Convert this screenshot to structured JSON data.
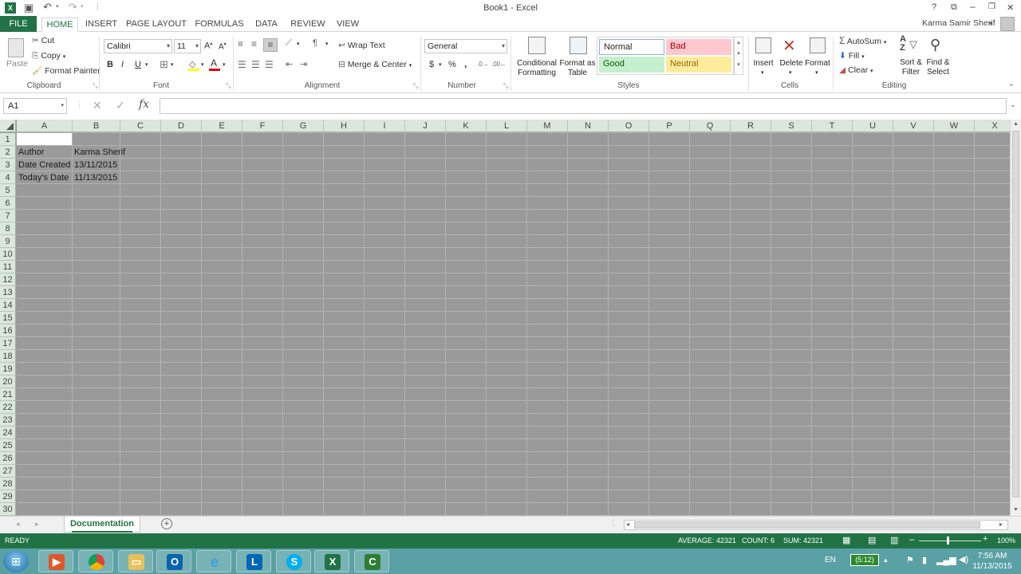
{
  "window": {
    "title": "Book1 - Excel",
    "user": "Karma Samir Sherif",
    "help_glyph": "?",
    "min_glyph": "–",
    "restore_glyph": "❐",
    "close_glyph": "✕"
  },
  "tabs": [
    "FILE",
    "HOME",
    "INSERT",
    "PAGE LAYOUT",
    "FORMULAS",
    "DATA",
    "REVIEW",
    "VIEW"
  ],
  "active_tab": "HOME",
  "clipboard": {
    "paste": "Paste",
    "cut": "Cut",
    "copy": "Copy",
    "format_painter": "Format Painter",
    "label": "Clipboard"
  },
  "font": {
    "name": "Calibri",
    "size": "11",
    "bold": "B",
    "italic": "I",
    "underline": "U",
    "label": "Font"
  },
  "alignment": {
    "wrap_text": "Wrap Text",
    "merge_center": "Merge & Center",
    "label": "Alignment"
  },
  "number": {
    "format": "General",
    "currency": "$",
    "percent": "%",
    "comma": ",",
    "label": "Number"
  },
  "styles": {
    "conditional_formatting": "Conditional Formatting",
    "format_as_table": "Format as Table",
    "normal": "Normal",
    "bad": "Bad",
    "good": "Good",
    "neutral": "Neutral",
    "label": "Styles"
  },
  "cells": {
    "insert": "Insert",
    "delete": "Delete",
    "format": "Format",
    "label": "Cells"
  },
  "editing": {
    "autosum": "AutoSum",
    "fill": "Fill",
    "clear": "Clear",
    "sort_filter": "Sort & Filter",
    "find_select": "Find & Select",
    "label": "Editing"
  },
  "formula_bar": {
    "name_box": "A1",
    "cancel": "✕",
    "enter": "✓",
    "fx": "fx",
    "value": ""
  },
  "columns": [
    "A",
    "B",
    "C",
    "D",
    "E",
    "F",
    "G",
    "H",
    "I",
    "J",
    "K",
    "L",
    "M",
    "N",
    "O",
    "P",
    "Q",
    "R",
    "S",
    "T",
    "U",
    "V",
    "W",
    "X"
  ],
  "rows": [
    "1",
    "2",
    "3",
    "4",
    "5",
    "6",
    "7",
    "8",
    "9",
    "10",
    "11",
    "12",
    "13",
    "14",
    "15",
    "16",
    "17",
    "18",
    "19",
    "20",
    "21",
    "22",
    "23",
    "24",
    "25",
    "26",
    "27",
    "28",
    "29",
    "30"
  ],
  "cells_data": [
    {
      "ref": "A2",
      "value": "Author"
    },
    {
      "ref": "B2",
      "value": "Karma Sherif"
    },
    {
      "ref": "A3",
      "value": "Date Created"
    },
    {
      "ref": "B3",
      "value": "13/11/2015"
    },
    {
      "ref": "A4",
      "value": "Today's Date"
    },
    {
      "ref": "B4",
      "value": "11/13/2015"
    }
  ],
  "sheets": [
    "Documentation"
  ],
  "status": {
    "mode": "READY",
    "average": "AVERAGE: 42321",
    "count": "COUNT: 6",
    "sum": "SUM: 42321",
    "zoom": "100%"
  },
  "taskbar": {
    "lang": "EN",
    "battery": "(5:12)",
    "time": "7:56 AM",
    "date": "11/13/2015",
    "apps": [
      "start",
      "media-player",
      "chrome",
      "file-explorer",
      "outlook",
      "internet-explorer",
      "lync",
      "skype",
      "excel",
      "camtasia"
    ]
  },
  "colors": {
    "excel_green": "#217346",
    "header_green": "#dbe6dd",
    "grid_gray": "#9a9a9a",
    "bad_fill": "#ffc7ce",
    "good_fill": "#c6efce",
    "neutral_fill": "#ffeb9c",
    "taskbar": "#5aa1a5"
  }
}
